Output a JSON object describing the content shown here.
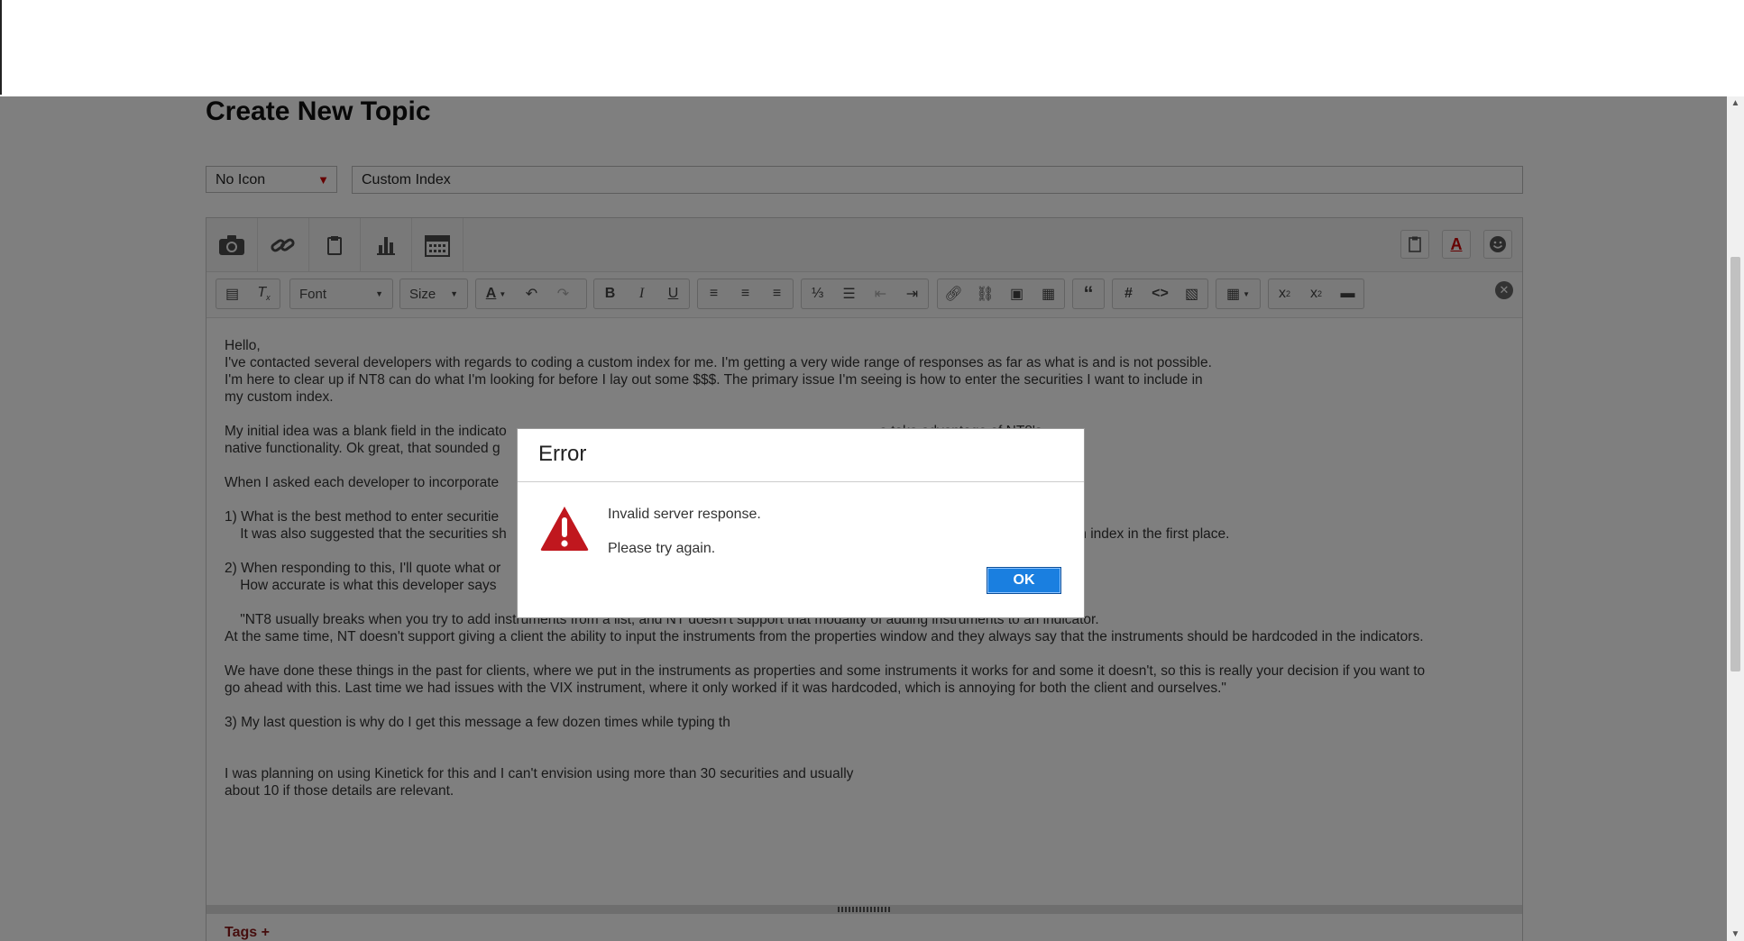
{
  "page": {
    "title": "Create New Topic",
    "icon_select": "No Icon",
    "subject_value": "Custom Index"
  },
  "attach_toolbar": {
    "left_icons": [
      "camera-icon",
      "link-icon",
      "clipboard-icon",
      "bar-chart-icon",
      "calendar-icon"
    ],
    "right_icons": [
      "paste-icon",
      "font-color-icon",
      "smiley-icon"
    ]
  },
  "format_toolbar": {
    "font_label": "Font",
    "size_label": "Size"
  },
  "editor_text": [
    "Hello,",
    "I've contacted several developers with regards to coding a custom index for me. I'm getting a very wide range of responses as far as what is and is not possible.",
    "I'm here to clear up if NT8 can do what I'm looking for before I lay out some $$$. The primary issue I'm seeing is how to enter the securities I want to include in",
    "my custom index.",
    "",
    "My initial idea was a blank field in the indicato                                                                                                o take advantage of NT8's",
    "native functionality. Ok great, that sounded g",
    "",
    "When I asked each developer to incorporate                                                                                                        my questions...",
    "",
    "1) What is the best method to enter securitie",
    "    It was also suggested that the securities sh                                                                                                  es the effectiveness of a custom index in the first place.",
    "",
    "2) When responding to this, I'll quote what or",
    "    How accurate is what this developer says",
    "",
    "    \"NT8 usually breaks when you try to add instruments from a list, and NT doesn't support that modality of adding instruments to an indicator.",
    "At the same time, NT doesn't support giving a client the ability to input the instruments from the properties window and they always say that the instruments should be hardcoded in the indicators.",
    "",
    "We have done these things in the past for clients, where we put in the instruments as properties and some instruments it works for and some it doesn't, so this is really your decision if you want to",
    "go ahead with this. Last time we had issues with the VIX instrument, where it only worked if it was hardcoded, which is annoying for both the client and ourselves.\"",
    "",
    "3) My last question is why do I get this message a few dozen times while typing th",
    "",
    "",
    "I was planning on using Kinetick for this and I can't envision using more than 30 securities and usually",
    "about 10 if those details are relevant."
  ],
  "tags_label": "Tags +",
  "dialog": {
    "title": "Error",
    "message": "Invalid server response.",
    "submessage": "Please try again.",
    "ok_label": "OK",
    "warning_color": "#c0171e",
    "ok_color": "#1a7fe0"
  }
}
